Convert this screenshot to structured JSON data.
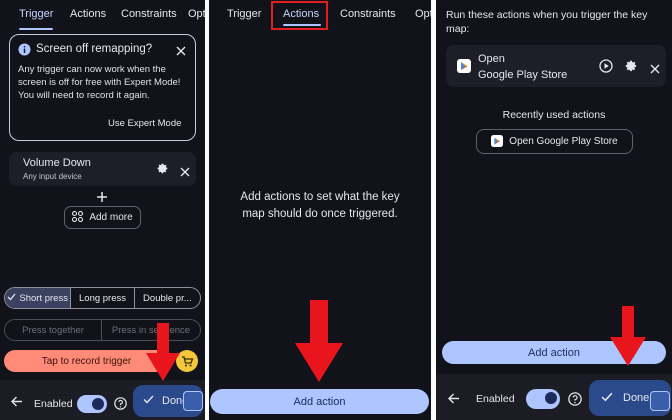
{
  "panel1": {
    "tabs": [
      "Trigger",
      "Actions",
      "Constraints",
      "Opti"
    ],
    "notice": {
      "title": "Screen off remapping?",
      "body": "Any trigger can now work when the screen is off for free with Expert Mode! You will need to record it again.",
      "action": "Use Expert Mode"
    },
    "trigger_item": {
      "title": "Volume Down",
      "subtitle": "Any input device"
    },
    "add_more": "Add more",
    "press_types": [
      "Short press",
      "Long press",
      "Double pr..."
    ],
    "press_modes": [
      "Press together",
      "Press in sequence"
    ],
    "record_button": "Tap to record trigger",
    "bottom": {
      "enabled_label": "Enabled",
      "done_label": "Done"
    }
  },
  "panel2": {
    "tabs": [
      "Trigger",
      "Actions",
      "Constraints",
      "Opti"
    ],
    "empty_message": "Add actions to set what the key map should do once triggered.",
    "add_action": "Add action"
  },
  "panel3": {
    "intro": "Run these actions when you trigger the key map:",
    "action_item": {
      "line1": "Open",
      "line2": "Google Play Store"
    },
    "recent_heading": "Recently used actions",
    "recent_chip": "Open Google Play Store",
    "add_action": "Add action",
    "bottom": {
      "enabled_label": "Enabled",
      "done_label": "Done"
    }
  },
  "colors": {
    "background": "#12131a",
    "accent": "#aec6ff",
    "record": "#ff8a78",
    "arrow": "#e8161c",
    "highlight_box": "#e02020"
  },
  "icons": [
    "close-icon",
    "gear-icon",
    "plus-icon",
    "scan-icon",
    "check-icon",
    "help-icon",
    "back-arrow-icon",
    "play-icon",
    "play-store-icon",
    "cart-icon"
  ]
}
